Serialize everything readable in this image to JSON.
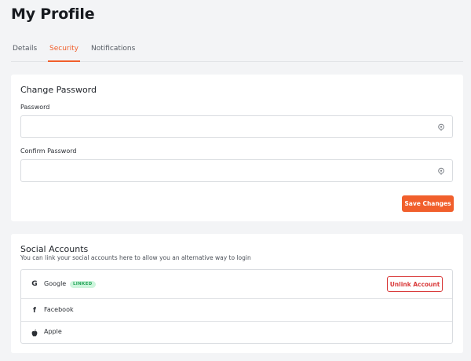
{
  "page": {
    "title": "My Profile"
  },
  "tabs": [
    {
      "label": "Details",
      "active": false
    },
    {
      "label": "Security",
      "active": true
    },
    {
      "label": "Notifications",
      "active": false
    }
  ],
  "change_password": {
    "title": "Change Password",
    "password": {
      "label": "Password",
      "value": "",
      "placeholder": ""
    },
    "confirm_password": {
      "label": "Confirm Password",
      "value": "",
      "placeholder": ""
    },
    "save_label": "Save Changes"
  },
  "social_accounts": {
    "title": "Social Accounts",
    "subtitle": "You can link your social accounts here to allow you an alternative way to login",
    "items": [
      {
        "name": "Google",
        "icon": "google-icon",
        "badge": "LINKED",
        "action": "Unlink Account"
      },
      {
        "name": "Facebook",
        "icon": "facebook-icon"
      },
      {
        "name": "Apple",
        "icon": "apple-icon"
      }
    ]
  },
  "colors": {
    "accent": "#f15f2c",
    "danger": "#d93a3a",
    "badge_bg": "#cdf5dc",
    "badge_text": "#25a55a",
    "background": "#f3f4f6"
  }
}
